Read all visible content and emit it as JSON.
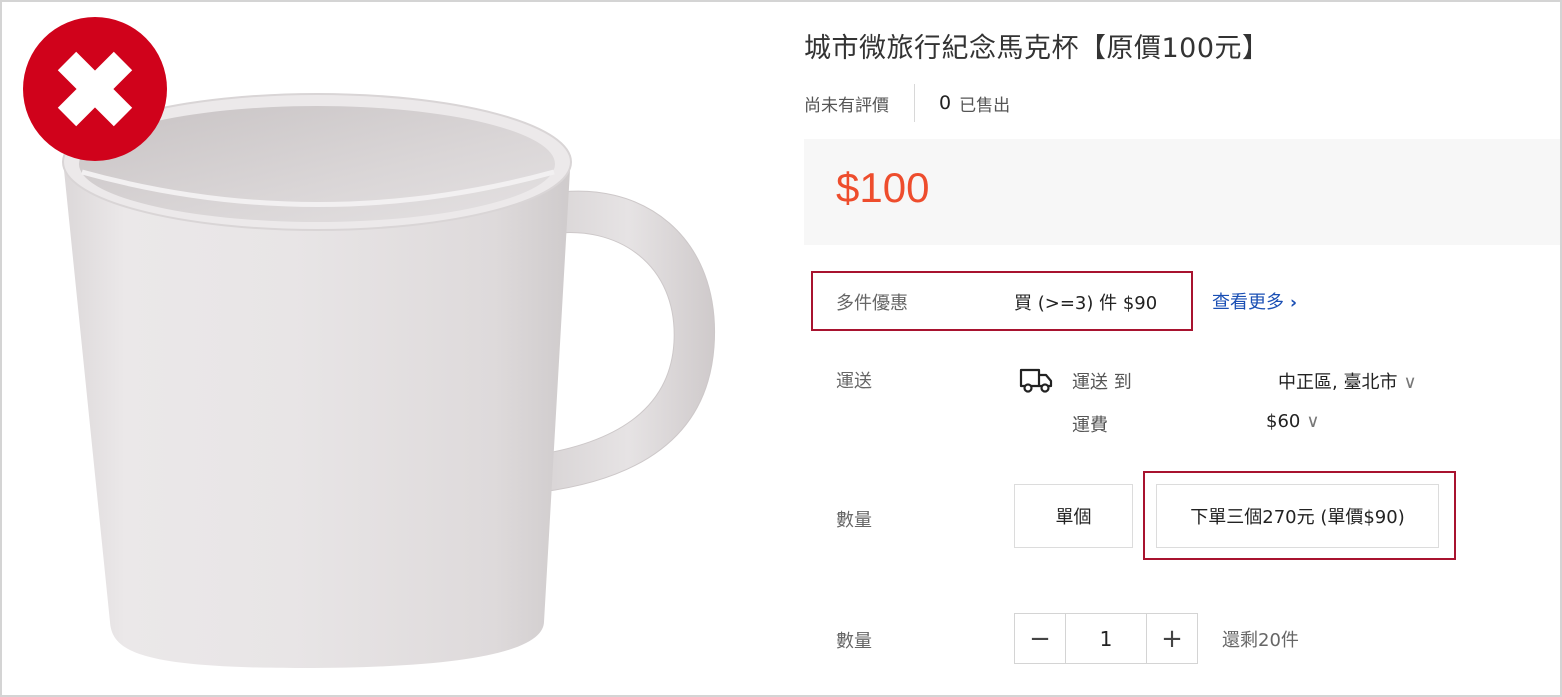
{
  "product": {
    "title": "城市微旅行紀念馬克杯【原價100元】",
    "rating_text": "尚未有評價",
    "sold_count": "0",
    "sold_label": "已售出",
    "price": "$100"
  },
  "bulk_discount": {
    "label": "多件優惠",
    "text": "買 (>=3) 件 $90",
    "see_more": "查看更多",
    "see_more_icon": "chevron-right-icon"
  },
  "shipping": {
    "label": "運送",
    "icon": "truck-icon",
    "deliver_to_label": "運送 到",
    "location": "中正區, 臺北市",
    "fee_label": "運費",
    "fee": "$60",
    "dropdown_icon": "chevron-down-icon"
  },
  "options": {
    "label": "數量",
    "items": [
      "單個",
      "下單三個270元 (單價$90)"
    ]
  },
  "quantity": {
    "label": "數量",
    "decrement": "−",
    "value": "1",
    "increment": "+",
    "stock_text": "還剩20件"
  },
  "image": {
    "subject": "mug",
    "reject_icon": "x-mark-icon"
  },
  "colors": {
    "price": "#ee4d2d",
    "highlight_border": "#a8132f",
    "link": "#1a4fb4",
    "reject_badge": "#d0021b"
  }
}
